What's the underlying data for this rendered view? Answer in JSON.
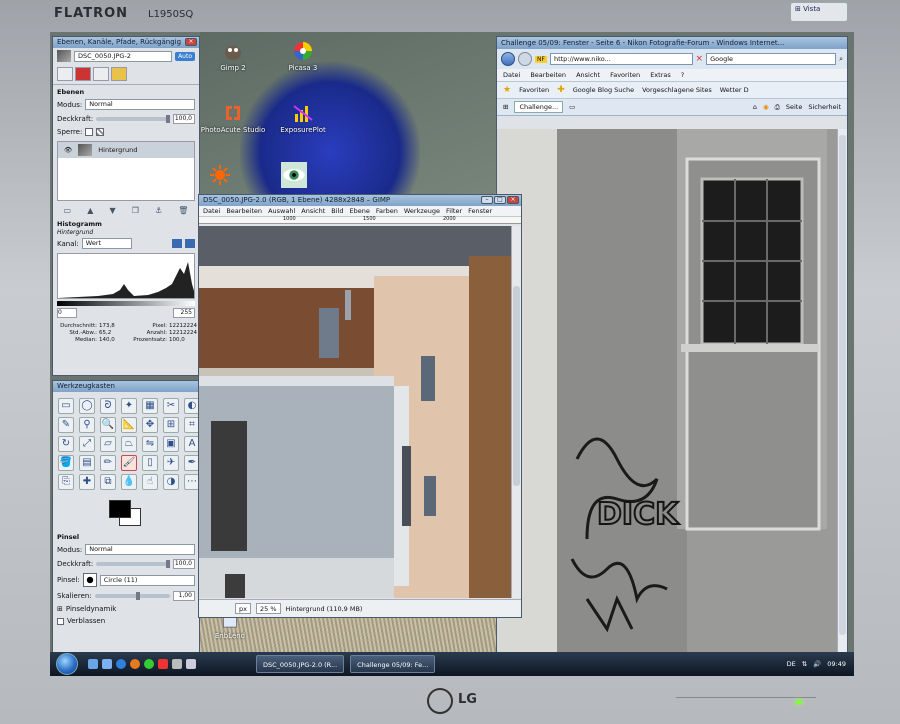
{
  "monitor": {
    "brand": "FLATRON",
    "model": "L1950SQ",
    "maker": "LG"
  },
  "desktop": {
    "icons": [
      {
        "label": "Gimp 2"
      },
      {
        "label": "Picasa 3"
      },
      {
        "label": "PhotoAcute Studio"
      },
      {
        "label": "ExposurePlot"
      },
      {
        "label": "EnbLend"
      }
    ]
  },
  "layers_dock": {
    "title": "Ebenen, Kanäle, Pfade, Rückgängig",
    "image_select": "DSC_0050.JPG-2",
    "auto_label": "Auto",
    "section_layers": "Ebenen",
    "mode_label": "Modus:",
    "mode_value": "Normal",
    "opacity_label": "Deckkraft:",
    "opacity_value": "100,0",
    "lock_label": "Sperre:",
    "layer_name": "Hintergrund",
    "section_histogram": "Histogramm",
    "histogram_subtitle": "Hintergrund",
    "channel_label": "Kanal:",
    "channel_value": "Wert",
    "range_min": "0",
    "range_max": "255",
    "stats": [
      {
        "k": "Durchschnitt:",
        "v": "173,8",
        "k2": "Pixel:",
        "v2": "12212224"
      },
      {
        "k": "Std.-Abw.:",
        "v": "65,2",
        "k2": "Anzahl:",
        "v2": "12212224"
      },
      {
        "k": "Median:",
        "v": "140,0",
        "k2": "Prozentsatz:",
        "v2": "100,0"
      }
    ]
  },
  "toolbox": {
    "title": "Werkzeugkasten",
    "brush_section": "Pinsel",
    "mode_label": "Modus:",
    "mode_value": "Normal",
    "opacity_label": "Deckkraft:",
    "opacity_value": "100,0",
    "brush_label": "Pinsel:",
    "brush_value": "Circle (11)",
    "scale_label": "Skalieren:",
    "scale_value": "1,00",
    "dynamics_label": "Pinseldynamik",
    "fade_label": "Verblassen"
  },
  "image_window": {
    "title": "DSC_0050.JPG-2.0 (RGB, 1 Ebene) 4288x2848 – GIMP",
    "menu": [
      "Datei",
      "Bearbeiten",
      "Auswahl",
      "Ansicht",
      "Bild",
      "Ebene",
      "Farben",
      "Werkzeuge",
      "Filter",
      "Fenster"
    ],
    "ruler_marks": [
      "1000",
      "1500",
      "2000"
    ],
    "unit": "px",
    "zoom": "25 %",
    "status_text": "Hintergrund (110,9 MB)"
  },
  "browser": {
    "title": "Challenge 05/09: Fenster - Seite 6 - Nikon Fotografie-Forum - Windows Internet...",
    "url": "http://www.niko...",
    "search_placeholder": "Google",
    "menu": [
      "Datei",
      "Bearbeiten",
      "Ansicht",
      "Favoriten",
      "Extras",
      "?"
    ],
    "favorites_label": "Favoriten",
    "fav_items": [
      "Google Blog Suche",
      "Vorgeschlagene Sites",
      "Wetter D"
    ],
    "tab_label": "Challenge...",
    "page_label": "Seite",
    "security_label": "Sicherheit",
    "graffiti_text": "DICK"
  },
  "taskbar": {
    "tasks": [
      "DSC_0050.JPG-2.0 (R...",
      "Challenge 05/09: Fe..."
    ],
    "lang": "DE",
    "clock": "09:49"
  }
}
